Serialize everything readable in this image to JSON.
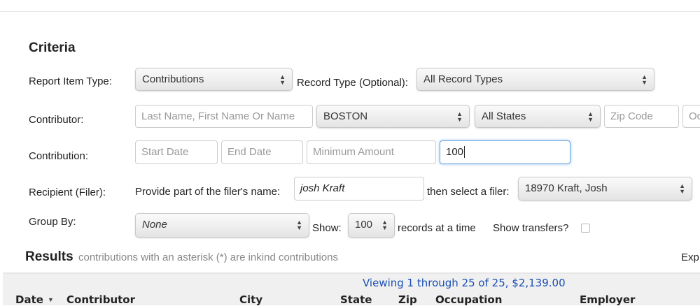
{
  "criteria": {
    "title": "Criteria",
    "report_item_type": {
      "label": "Report Item Type:",
      "value": "Contributions"
    },
    "record_type": {
      "label": "Record Type (Optional):",
      "value": "All Record Types"
    },
    "contributor": {
      "label": "Contributor:",
      "name_placeholder": "Last Name, First Name Or Name",
      "city": "BOSTON",
      "state": "All States",
      "zip_placeholder": "Zip Code",
      "occupation_placeholder": "Oc"
    },
    "contribution": {
      "label": "Contribution:",
      "start_placeholder": "Start Date",
      "end_placeholder": "End Date",
      "min_placeholder": "Minimum Amount",
      "max_value": "100"
    },
    "recipient": {
      "label": "Recipient (Filer):",
      "name_prompt": "Provide part of the filer's name:",
      "name_value": "josh Kraft",
      "select_prompt": "then select a filer:",
      "filer": "18970 Kraft, Josh"
    },
    "group_by": {
      "label": "Group By:",
      "value": "None",
      "show_label": "Show:",
      "show_value": "100",
      "records_label": "records at a time",
      "transfers_label": "Show transfers?",
      "transfers_checked": false
    }
  },
  "results": {
    "title": "Results",
    "note": "contributions with an asterisk (*) are inkind contributions",
    "export": "Exp",
    "summary": "Viewing 1 through 25 of 25, $2,139.00",
    "columns": [
      "Date",
      "Contributor",
      "City",
      "State",
      "Zip",
      "Occupation",
      "Employer"
    ]
  }
}
